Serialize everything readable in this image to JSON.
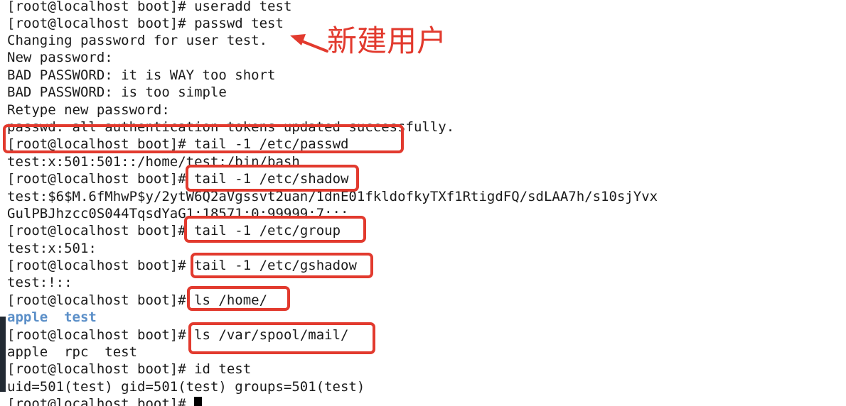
{
  "terminal": {
    "lines": [
      {
        "prompt": "[root@localhost boot]#",
        "command": " useradd test"
      },
      {
        "prompt": "[root@localhost boot]#",
        "command": " passwd test"
      },
      {
        "text": "Changing password for user test."
      },
      {
        "text": "New password:"
      },
      {
        "text": "BAD PASSWORD: it is WAY too short"
      },
      {
        "text": "BAD PASSWORD: is too simple"
      },
      {
        "text": "Retype new password:"
      },
      {
        "text": "passwd: all authentication tokens updated successfully."
      },
      {
        "prompt": "[root@localhost boot]#",
        "command": " tail -1 /etc/passwd"
      },
      {
        "text": "test:x:501:501::/home/test:/bin/bash"
      },
      {
        "prompt": "[root@localhost boot]#",
        "command": " tail -1 /etc/shadow"
      },
      {
        "text": "test:$6$M.6fMhwP$y/2ytW6Q2aVgssvt2uan/1dnE01fkldofkyTXf1RtigdFQ/sdLAA7h/s10sjYvx"
      },
      {
        "text": "GulPBJhzcc0S044TqsdYaG1:18571:0:99999:7:::"
      },
      {
        "prompt": "[root@localhost boot]#",
        "command": " tail -1 /etc/group"
      },
      {
        "text": "test:x:501:"
      },
      {
        "prompt": "[root@localhost boot]#",
        "command": " tail -1 /etc/gshadow"
      },
      {
        "text": "test:!::"
      },
      {
        "prompt": "[root@localhost boot]#",
        "command": " ls /home/"
      },
      {
        "dirs": [
          "apple",
          "test"
        ]
      },
      {
        "prompt": "[root@localhost boot]#",
        "command": " ls /var/spool/mail/"
      },
      {
        "text": "apple  rpc  test"
      },
      {
        "prompt": "[root@localhost boot]#",
        "command": " id test"
      },
      {
        "text": "uid=501(test) gid=501(test) groups=501(test)"
      },
      {
        "prompt": "[root@localhost boot]#",
        "command": " "
      }
    ]
  },
  "annotation": {
    "label": "新建用户",
    "color": "#e23a2e"
  },
  "colors": {
    "background": "#ffffff",
    "text": "#1a1a1a",
    "directory": "#5b8fc8",
    "highlight_box": "#e23a2e"
  }
}
